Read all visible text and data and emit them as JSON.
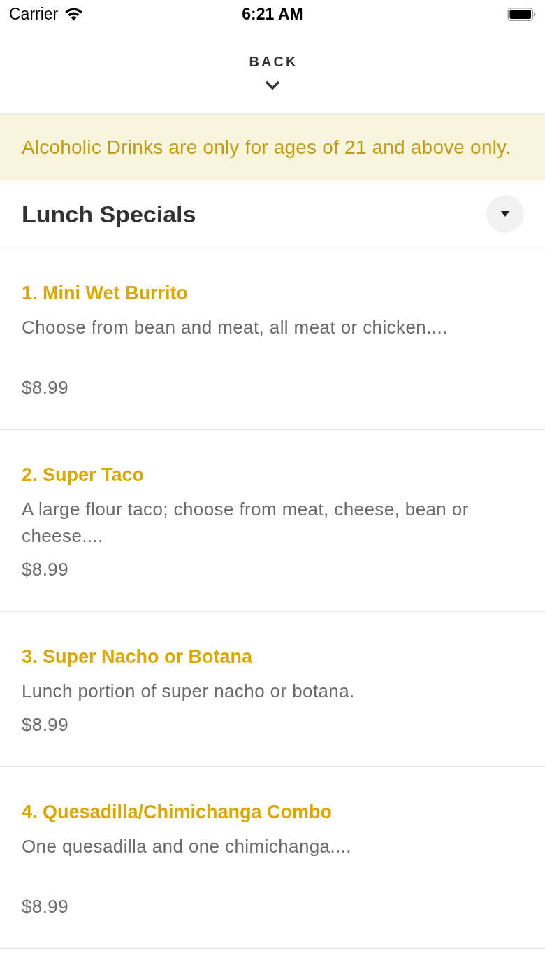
{
  "status_bar": {
    "carrier": "Carrier",
    "time": "6:21 AM"
  },
  "nav": {
    "back_label": "BACK"
  },
  "notice": "Alcoholic Drinks are only for ages of 21 and above only.",
  "section": {
    "title": "Lunch Specials"
  },
  "items": [
    {
      "name": "1. Mini Wet Burrito",
      "description": "Choose from bean and meat, all meat or chicken....\n",
      "price": "$8.99"
    },
    {
      "name": "2. Super Taco",
      "description": "A large flour taco; choose from meat, cheese, bean or cheese....",
      "price": "$8.99"
    },
    {
      "name": "3. Super Nacho or Botana",
      "description": "Lunch portion of super nacho or botana.",
      "price": "$8.99"
    },
    {
      "name": "4. Quesadilla/Chimichanga Combo",
      "description": "One quesadilla and one chimichanga....\n",
      "price": "$8.99"
    }
  ]
}
